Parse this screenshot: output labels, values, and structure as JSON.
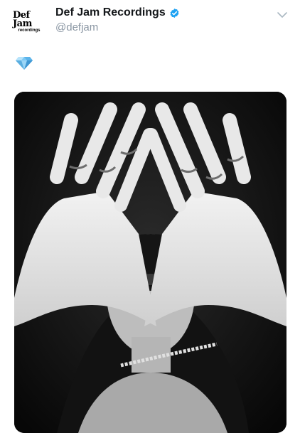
{
  "tweet": {
    "avatar_logo": {
      "top": "Def Jam",
      "bottom": "recordings"
    },
    "display_name": "Def Jam Recordings",
    "handle": "@defjam",
    "verified": true,
    "verified_icon": "verified-badge-icon",
    "menu_icon": "chevron-down-icon",
    "text_emoji": "💎",
    "text_icon": "gem-icon",
    "media": {
      "kind": "photo",
      "subject": "black-and-white photo of hands forming a triangle in front of a face"
    }
  },
  "colors": {
    "name": "#14171a",
    "handle": "#8a96a3",
    "verified": "#1da1f2",
    "caret": "#aab8c2"
  }
}
